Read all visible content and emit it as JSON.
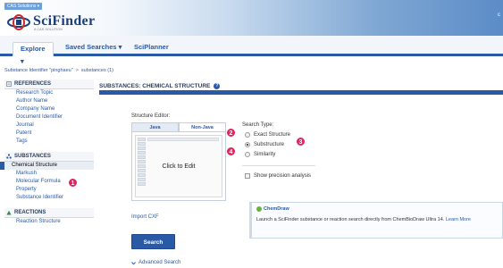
{
  "header": {
    "badge": "CAS Solutions ▾",
    "logo_text": "SciFinder",
    "logo_sub": "A CAS SOLUTION",
    "right_marker": "c"
  },
  "nav": {
    "tabs": [
      {
        "label": "Explore ▾"
      },
      {
        "label": "Saved Searches ▾"
      },
      {
        "label": "SciPlanner"
      }
    ]
  },
  "breadcrumb": {
    "first": "Substance Identifier \"pinghaeu\"",
    "separator": ">",
    "second": "substances (1)"
  },
  "sidebar": {
    "references": {
      "heading": "REFERENCES",
      "items": [
        "Research Topic",
        "Author Name",
        "Company Name",
        "Document Identifier",
        "Journal",
        "Patent",
        "Tags"
      ]
    },
    "substances": {
      "heading": "SUBSTANCES",
      "items": [
        "Chemical Structure",
        "Markush",
        "Molecular Formula",
        "Property",
        "Substance Identifier"
      ]
    },
    "reactions": {
      "heading": "REACTIONS",
      "items": [
        "Reaction Structure"
      ]
    }
  },
  "main": {
    "title": "SUBSTANCES: CHEMICAL STRUCTURE",
    "help_glyph": "?",
    "structure_editor_label": "Structure Editor:",
    "editor_tabs": [
      "Java",
      "Non-Java"
    ],
    "click_to_edit": "Click to Edit",
    "import_cxf": "Import CXF",
    "search_button": "Search",
    "advanced_search": "Advanced Search"
  },
  "search_type": {
    "label": "Search Type:",
    "options": [
      "Exact Structure",
      "Substructure",
      "Similarity"
    ],
    "selected": "Substructure",
    "precision_label": "Show precision analysis"
  },
  "chemdraw": {
    "title": "ChemDraw",
    "text": "Launch a SciFinder substance or reaction search directly from ChemBioDraw Ultra 14.",
    "link": "Learn More"
  },
  "markers": [
    "1",
    "2",
    "3",
    "4"
  ],
  "colors": {
    "accent": "#2a5aa6",
    "marker": "#e0245e",
    "header_right": "#5b8cc7"
  }
}
